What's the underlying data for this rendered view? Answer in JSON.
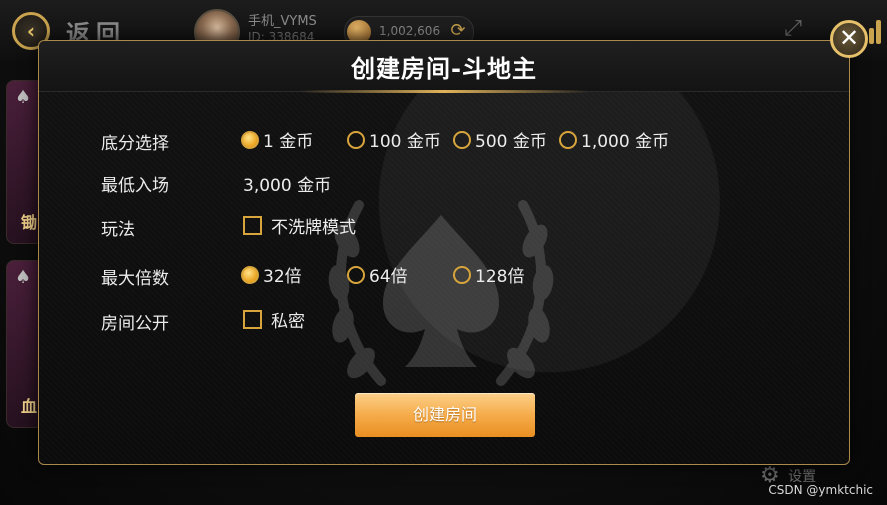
{
  "topbar": {
    "back_label": "返回",
    "username": "手机_VYMS",
    "user_id": "ID: 338684",
    "coins": "1,002,606"
  },
  "side_cards": [
    {
      "text": "锄"
    },
    {
      "text": "血"
    }
  ],
  "modal": {
    "title": "创建房间-斗地主",
    "rows": {
      "base_score": {
        "label": "底分选择",
        "options": [
          "1 金币",
          "100 金币",
          "500 金币",
          "1,000 金币"
        ],
        "selected": "1 金币"
      },
      "min_entry": {
        "label": "最低入场",
        "value": "3,000 金币"
      },
      "play_mode": {
        "label": "玩法",
        "checkbox_label": "不洗牌模式",
        "checked": false
      },
      "max_multiplier": {
        "label": "最大倍数",
        "options": [
          "32倍",
          "64倍",
          "128倍"
        ],
        "selected": "32倍"
      },
      "room_public": {
        "label": "房间公开",
        "checkbox_label": "私密",
        "checked": false
      }
    },
    "create_button": "创建房间"
  },
  "footer": {
    "settings_label": "设置",
    "watermark": "CSDN @ymktchic"
  },
  "colors": {
    "gold": "#d7a53c",
    "button_orange": "#f6ac4a",
    "text": "#ececec"
  },
  "icons": {
    "back": "arrow-left-icon",
    "refresh": "refresh-icon",
    "fullscreen": "fullscreen-icon",
    "close": "close-icon",
    "settings": "gear-icon",
    "emblem": "spade-laurel-emblem"
  }
}
